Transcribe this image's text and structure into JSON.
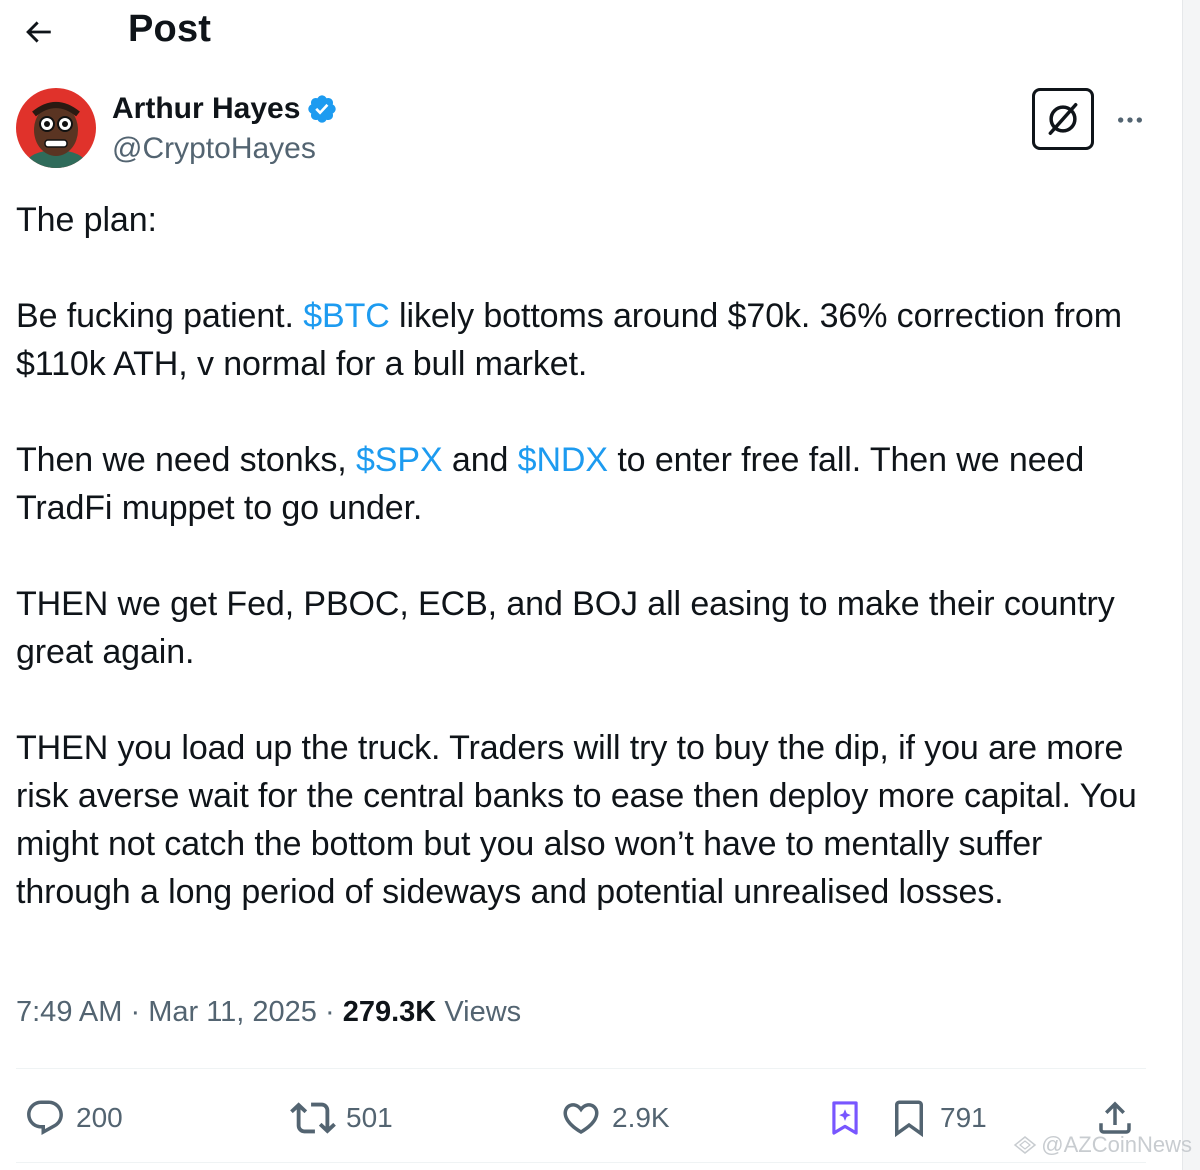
{
  "header": {
    "title": "Post"
  },
  "author": {
    "name": "Arthur Hayes",
    "handle": "@CryptoHayes",
    "verified": true
  },
  "tweet": {
    "paragraphs": [
      {
        "segments": [
          {
            "text": "The plan:"
          }
        ]
      },
      {
        "segments": [
          {
            "text": "Be fucking patient. "
          },
          {
            "text": "$BTC",
            "cashtag": true
          },
          {
            "text": " likely bottoms around $70k. 36% correction from $110k ATH, v normal for a bull market."
          }
        ]
      },
      {
        "segments": [
          {
            "text": "Then we need stonks, "
          },
          {
            "text": "$SPX",
            "cashtag": true
          },
          {
            "text": " and "
          },
          {
            "text": "$NDX",
            "cashtag": true
          },
          {
            "text": " to enter free fall. Then we need TradFi muppet to go under."
          }
        ]
      },
      {
        "segments": [
          {
            "text": "THEN we get Fed, PBOC, ECB, and BOJ all easing to make their country great again."
          }
        ]
      },
      {
        "segments": [
          {
            "text": "THEN you load up the truck. Traders will try to buy the dip, if you are more risk averse wait for the central banks to ease then deploy more capital. You might not catch the bottom but you also won’t have to mentally suffer through a long period of sideways and potential unrealised losses."
          }
        ]
      }
    ]
  },
  "meta": {
    "time": "7:49 AM",
    "separator": "·",
    "date": "Mar 11, 2025",
    "views_count": "279.3K",
    "views_label": "Views"
  },
  "actions": {
    "replies": "200",
    "reposts": "501",
    "likes": "2.9K",
    "bookmarks": "791"
  },
  "watermark": {
    "text": "@AZCoinNews"
  },
  "colors": {
    "text": "#0f1419",
    "secondary": "#536471",
    "link": "#1d9bf0",
    "verified": "#1d9bf0",
    "divider": "#eff3f4",
    "grok_purple": "#7856ff"
  },
  "icons": {
    "back": "arrow-left-icon",
    "verified": "verified-badge-icon",
    "grok": "grok-icon",
    "more": "more-horizontal-icon",
    "reply": "reply-icon",
    "repost": "repost-icon",
    "like": "heart-icon",
    "grok_analyze": "grok-analyze-icon",
    "bookmark": "bookmark-icon",
    "share": "share-icon"
  }
}
